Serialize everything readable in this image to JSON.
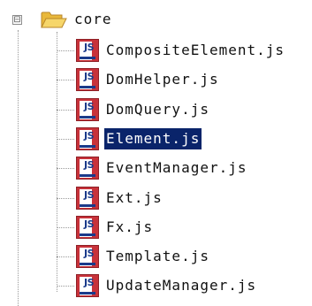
{
  "tree": {
    "root": {
      "label": "core",
      "expander": "⊟",
      "icon": "folder-open-icon"
    },
    "files": [
      {
        "label": "CompositeElement.js",
        "icon": "js-file-icon",
        "selected": false
      },
      {
        "label": "DomHelper.js",
        "icon": "js-file-icon",
        "selected": false
      },
      {
        "label": "DomQuery.js",
        "icon": "js-file-icon",
        "selected": false
      },
      {
        "label": "Element.js",
        "icon": "js-file-icon",
        "selected": true
      },
      {
        "label": "EventManager.js",
        "icon": "js-file-icon",
        "selected": false
      },
      {
        "label": "Ext.js",
        "icon": "js-file-icon",
        "selected": false
      },
      {
        "label": "Fx.js",
        "icon": "js-file-icon",
        "selected": false
      },
      {
        "label": "Template.js",
        "icon": "js-file-icon",
        "selected": false
      },
      {
        "label": "UpdateManager.js",
        "icon": "js-file-icon",
        "selected": false
      }
    ],
    "icon_badge": "JS"
  },
  "colors": {
    "selection": "#0a246a",
    "selection_text": "#ffffff",
    "js_icon_red": "#c8323a",
    "js_icon_blue": "#1a3a8a",
    "folder": "#f2c94c"
  }
}
